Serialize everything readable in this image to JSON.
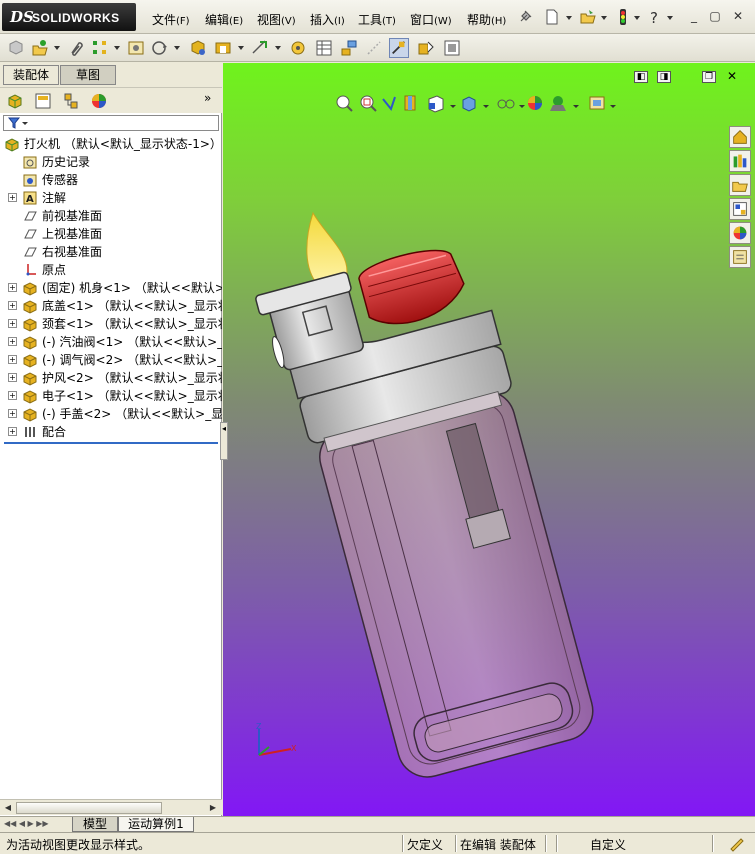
{
  "app": {
    "logo_ds": "DS",
    "logo_text": "SOLIDWORKS"
  },
  "menu": [
    {
      "label": "文件",
      "key": "(F)"
    },
    {
      "label": "编辑",
      "key": "(E)"
    },
    {
      "label": "视图",
      "key": "(V)"
    },
    {
      "label": "插入",
      "key": "(I)"
    },
    {
      "label": "工具",
      "key": "(T)"
    },
    {
      "label": "窗口",
      "key": "(W)"
    },
    {
      "label": "帮助",
      "key": "(H)"
    }
  ],
  "panel_tabs": {
    "assembly": "装配体",
    "sketch": "草图"
  },
  "tree": [
    {
      "label": "打火机 （默认<默认_显示状态-1>）",
      "icon": "assembly-icon",
      "expand": "",
      "level": 0
    },
    {
      "label": "历史记录",
      "icon": "history-folder-icon",
      "expand": "",
      "level": 1
    },
    {
      "label": "传感器",
      "icon": "sensor-icon",
      "expand": "",
      "level": 1
    },
    {
      "label": "注解",
      "icon": "annotation-icon",
      "expand": "+",
      "level": 1
    },
    {
      "label": "前视基准面",
      "icon": "plane-icon",
      "expand": "",
      "level": 1
    },
    {
      "label": "上视基准面",
      "icon": "plane-icon",
      "expand": "",
      "level": 1
    },
    {
      "label": "右视基准面",
      "icon": "plane-icon",
      "expand": "",
      "level": 1
    },
    {
      "label": "原点",
      "icon": "origin-icon",
      "expand": "",
      "level": 1
    },
    {
      "label": "(固定) 机身<1> （默认<<默认>_显",
      "icon": "part-icon",
      "expand": "+",
      "level": 1
    },
    {
      "label": "底盖<1> （默认<<默认>_显示状态",
      "icon": "part-icon",
      "expand": "+",
      "level": 1
    },
    {
      "label": "颈套<1> （默认<<默认>_显示状态",
      "icon": "part-icon",
      "expand": "+",
      "level": 1
    },
    {
      "label": "(-) 汽油阀<1> （默认<<默认>_显",
      "icon": "part-icon",
      "expand": "+",
      "level": 1
    },
    {
      "label": "(-) 调气阀<2> （默认<<默认>_显",
      "icon": "part-icon",
      "expand": "+",
      "level": 1
    },
    {
      "label": "护风<2> （默认<<默认>_显示状态",
      "icon": "part-icon",
      "expand": "+",
      "level": 1
    },
    {
      "label": "电子<1> （默认<<默认>_显示状态",
      "icon": "part-icon",
      "expand": "+",
      "level": 1
    },
    {
      "label": "(-) 手盖<2> （默认<<默认>_显示",
      "icon": "part-icon",
      "expand": "+",
      "level": 1
    },
    {
      "label": "配合",
      "icon": "mates-icon",
      "expand": "+",
      "level": 1
    }
  ],
  "bottom_tabs": {
    "model": "模型",
    "motion": "运动算例1"
  },
  "status": {
    "message": "为活动视图更改显示样式。",
    "definition": "欠定义",
    "editing": "在编辑 装配体",
    "units": "自定义"
  },
  "colors": {
    "viewport_top": "#6ff31c",
    "viewport_bottom": "#8217f5",
    "selection_blue": "#316ac5"
  }
}
